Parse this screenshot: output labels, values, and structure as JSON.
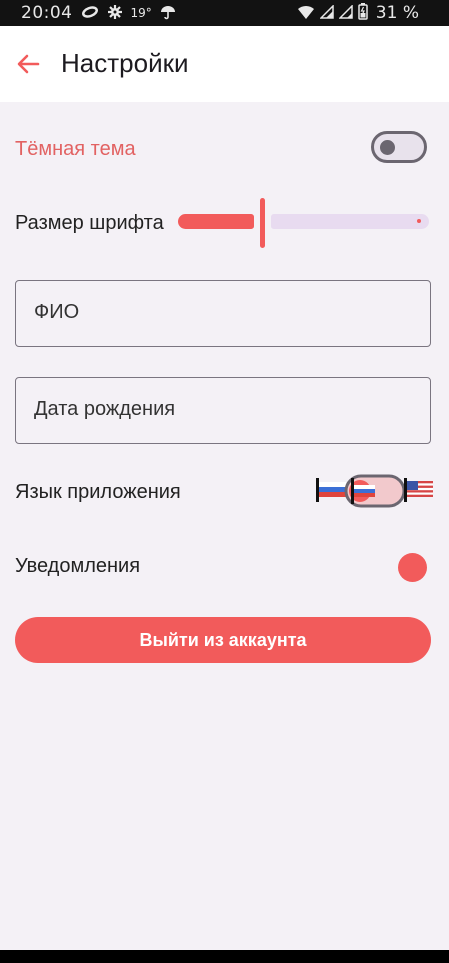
{
  "status_bar": {
    "time": "20:04",
    "temperature": "19°",
    "battery_percent": "31 %",
    "icons": [
      "link-icon",
      "settings-gear-icon",
      "umbrella-icon",
      "wifi-icon",
      "signal-icon",
      "signal-icon",
      "battery-icon"
    ]
  },
  "app_bar": {
    "title": "Настройки",
    "back_icon": "arrow-back-icon"
  },
  "settings": {
    "dark_theme": {
      "label": "Тёмная тема",
      "enabled": false
    },
    "font_size": {
      "label": "Размер шрифта",
      "value_fraction": 0.33
    },
    "name_field": {
      "placeholder": "ФИО",
      "value": ""
    },
    "birthdate_field": {
      "placeholder": "Дата рождения",
      "value": ""
    },
    "app_language": {
      "label": "Язык приложения",
      "options": [
        "ru-flag-icon",
        "us-flag-icon"
      ],
      "selected": "ru-flag-icon"
    },
    "notifications": {
      "label": "Уведомления",
      "enabled": true
    }
  },
  "logout_button": {
    "label": "Выйти из аккаунта"
  },
  "colors": {
    "accent": "#f25b5b",
    "background": "#f4f1f6",
    "surface": "#ffffff",
    "status_bar": "#121212"
  }
}
